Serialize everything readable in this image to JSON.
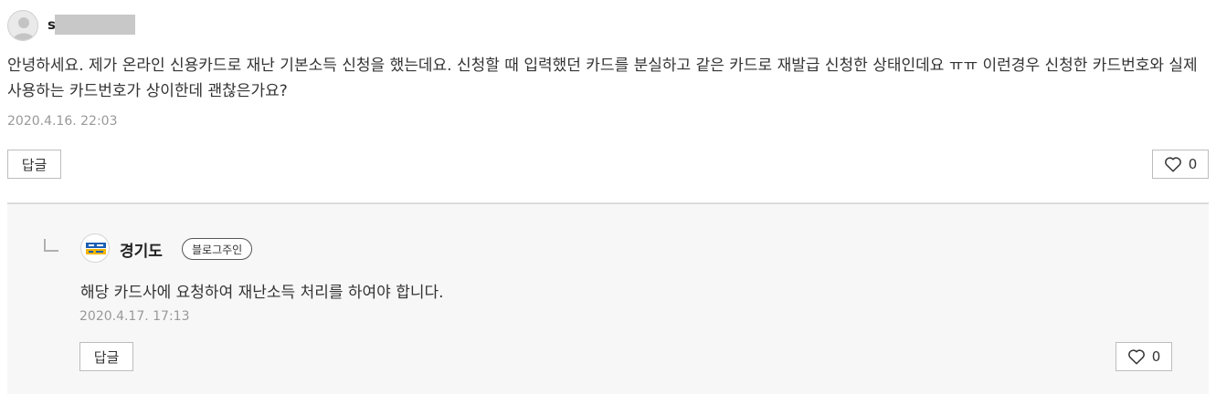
{
  "comment": {
    "author": "s",
    "text": "안녕하세요. 제가 온라인 신용카드로 재난 기본소득 신청을 했는데요. 신청할 때 입력했던 카드를 분실하고 같은 카드로 재발급 신청한 상태인데요 ㅠㅠ 이런경우 신청한 카드번호와 실제 사용하는 카드번호가 상이한데 괜찮은가요?",
    "date": "2020.4.16. 22:03",
    "reply_label": "답글",
    "like_count": "0"
  },
  "reply": {
    "author": "경기도",
    "badge": "블로그주인",
    "text": "해당 카드사에 요청하여 재난소득 처리를 하여야 합니다.",
    "date": "2020.4.17. 17:13",
    "reply_label": "답글",
    "like_count": "0"
  },
  "icons": {
    "avatar": "default-user-avatar-icon",
    "logo": "gyeonggi-logo-icon",
    "like": "heart-outline-icon",
    "elbow": "reply-elbow-icon"
  }
}
